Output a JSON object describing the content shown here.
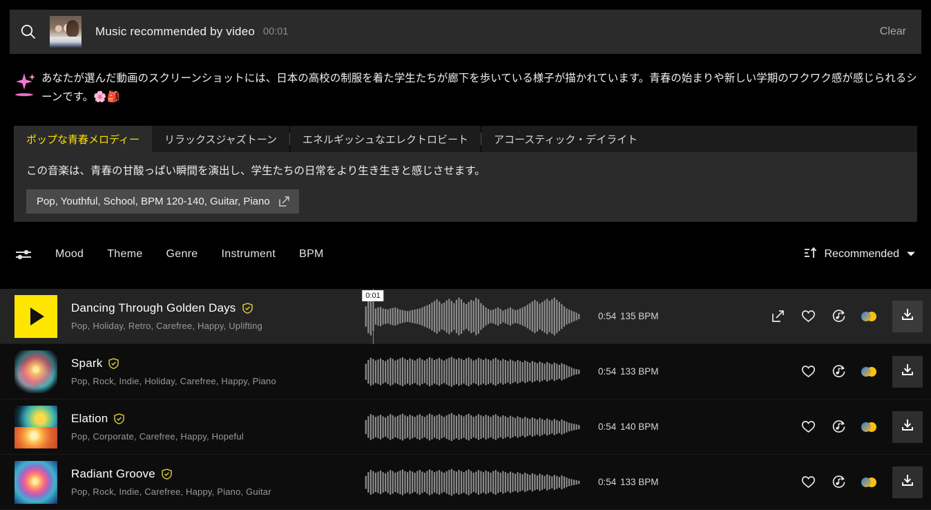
{
  "search": {
    "icon": "search-icon",
    "title": "Music recommended by video",
    "time": "00:01",
    "clear_label": "Clear",
    "thumbnail_alt": "video-frame-thumbnail"
  },
  "ai_summary": {
    "icon": "sparkle-icon",
    "text": "あなたが選んだ動画のスクリーンショットには、日本の高校の制服を着た学生たちが廊下を歩いている様子が描かれています。青春の始まりや新しい学期のワクワク感が感じられるシーンです。🌸🎒"
  },
  "tabs": [
    {
      "label": "ポップな青春メロディー",
      "active": true
    },
    {
      "label": "リラックスジャズトーン",
      "active": false
    },
    {
      "label": "エネルギッシュなエレクトロビート",
      "active": false
    },
    {
      "label": "アコースティック・デイライト",
      "active": false
    }
  ],
  "panel": {
    "description": "この音楽は、青春の甘酸っぱい瞬間を演出し、学生たちの日常をより生き生きと感じさせます。",
    "chip_label": "Pop, Youthful, School, BPM 120-140, Guitar, Piano",
    "chip_icon": "edit-icon"
  },
  "filters": {
    "icon": "sliders-icon",
    "items": [
      "Mood",
      "Theme",
      "Genre",
      "Instrument",
      "BPM"
    ],
    "sort": {
      "icon": "sort-ascending-icon",
      "label": "Recommended",
      "caret": "chevron-down-icon"
    }
  },
  "tracks": [
    {
      "title": "Dancing Through Golden Days",
      "verified": true,
      "tags": "Pop, Holiday, Retro, Carefree, Happy, Uplifting",
      "duration": "0:54",
      "bpm": "135 BPM",
      "playing": true,
      "playhead_time": "0:01",
      "thumb_type": "play-button",
      "actions": [
        "share-icon",
        "heart-icon",
        "similar-track-icon",
        "adobe-apps-icon",
        "download-icon"
      ]
    },
    {
      "title": "Spark",
      "verified": true,
      "tags": "Pop, Rock, Indie, Holiday, Carefree, Happy, Piano",
      "duration": "0:54",
      "bpm": "133 BPM",
      "playing": false,
      "playhead_time": "",
      "thumb_type": "artwork-1",
      "actions": [
        "heart-icon",
        "similar-track-icon",
        "adobe-apps-icon",
        "download-icon"
      ]
    },
    {
      "title": "Elation",
      "verified": true,
      "tags": "Pop, Corporate, Carefree, Happy, Hopeful",
      "duration": "0:54",
      "bpm": "140 BPM",
      "playing": false,
      "playhead_time": "",
      "thumb_type": "artwork-2",
      "actions": [
        "heart-icon",
        "similar-track-icon",
        "adobe-apps-icon",
        "download-icon"
      ]
    },
    {
      "title": "Radiant Groove",
      "verified": true,
      "tags": "Pop, Rock, Indie, Carefree, Happy, Piano, Guitar",
      "duration": "0:54",
      "bpm": "133 BPM",
      "playing": false,
      "playhead_time": "",
      "thumb_type": "artwork-3",
      "actions": [
        "heart-icon",
        "similar-track-icon",
        "adobe-apps-icon",
        "download-icon"
      ]
    }
  ],
  "colors": {
    "accent_yellow": "#ffe100",
    "play_button": "#ffe600",
    "background": "#000000",
    "bar_background": "#2b2b2b",
    "row_active": "#242424",
    "badge_yellow": "#d8c53a"
  },
  "chart_data": {
    "type": "bar",
    "title": "waveform-amplitudes",
    "series": [
      {
        "name": "Dancing Through Golden Days",
        "values": [
          38,
          62,
          70,
          54,
          30,
          34,
          36,
          30,
          28,
          26,
          30,
          32,
          34,
          30,
          26,
          24,
          22,
          20,
          22,
          24,
          26,
          28,
          30,
          34,
          38,
          42,
          46,
          52,
          58,
          64,
          56,
          48,
          52,
          60,
          66,
          58,
          50,
          62,
          70,
          64,
          52,
          46,
          54,
          62,
          58,
          70,
          64,
          50,
          42,
          34,
          28,
          24,
          26,
          30,
          34,
          28,
          22,
          26,
          30,
          34,
          28,
          24,
          26,
          30,
          34,
          38,
          44,
          50,
          56,
          62,
          56,
          48,
          54,
          60,
          66,
          58,
          64,
          70,
          62,
          54,
          46,
          38,
          30,
          26,
          22,
          18,
          14,
          10
        ]
      },
      {
        "name": "Spark",
        "values": [
          30,
          44,
          52,
          48,
          42,
          46,
          50,
          44,
          40,
          46,
          52,
          48,
          42,
          46,
          50,
          54,
          48,
          44,
          50,
          46,
          42,
          48,
          52,
          46,
          42,
          48,
          54,
          50,
          44,
          48,
          52,
          46,
          42,
          48,
          52,
          56,
          50,
          46,
          52,
          48,
          44,
          50,
          54,
          48,
          42,
          46,
          52,
          48,
          44,
          50,
          46,
          42,
          48,
          52,
          46,
          42,
          48,
          44,
          40,
          46,
          42,
          38,
          44,
          40,
          36,
          42,
          38,
          34,
          40,
          36,
          32,
          38,
          34,
          30,
          36,
          32,
          28,
          34,
          30,
          26,
          32,
          28,
          24,
          20,
          16,
          12,
          10,
          8
        ]
      },
      {
        "name": "Elation",
        "values": [
          26,
          40,
          48,
          44,
          38,
          42,
          46,
          40,
          36,
          42,
          48,
          44,
          38,
          42,
          46,
          50,
          44,
          40,
          46,
          42,
          38,
          44,
          48,
          42,
          38,
          44,
          50,
          46,
          40,
          44,
          48,
          42,
          38,
          44,
          48,
          52,
          46,
          42,
          48,
          44,
          40,
          46,
          50,
          44,
          38,
          42,
          48,
          44,
          40,
          46,
          42,
          38,
          44,
          48,
          42,
          38,
          44,
          40,
          36,
          42,
          38,
          34,
          40,
          36,
          32,
          38,
          34,
          30,
          36,
          32,
          28,
          34,
          30,
          26,
          32,
          28,
          24,
          30,
          26,
          22,
          28,
          24,
          20,
          16,
          14,
          12,
          10,
          8
        ]
      },
      {
        "name": "Radiant Groove",
        "values": [
          24,
          38,
          46,
          42,
          36,
          40,
          44,
          38,
          34,
          40,
          46,
          42,
          36,
          40,
          44,
          48,
          42,
          38,
          44,
          40,
          36,
          42,
          46,
          40,
          36,
          42,
          48,
          44,
          38,
          42,
          46,
          40,
          36,
          42,
          46,
          50,
          44,
          40,
          46,
          42,
          38,
          44,
          48,
          42,
          36,
          40,
          46,
          42,
          38,
          44,
          40,
          36,
          42,
          46,
          40,
          36,
          42,
          38,
          34,
          40,
          36,
          32,
          38,
          34,
          30,
          36,
          32,
          28,
          34,
          30,
          26,
          32,
          28,
          24,
          30,
          26,
          22,
          28,
          24,
          20,
          26,
          22,
          18,
          14,
          12,
          10,
          8,
          6
        ]
      }
    ],
    "xlabel": "time",
    "ylabel": "amplitude",
    "grid": false,
    "legend": "none"
  }
}
